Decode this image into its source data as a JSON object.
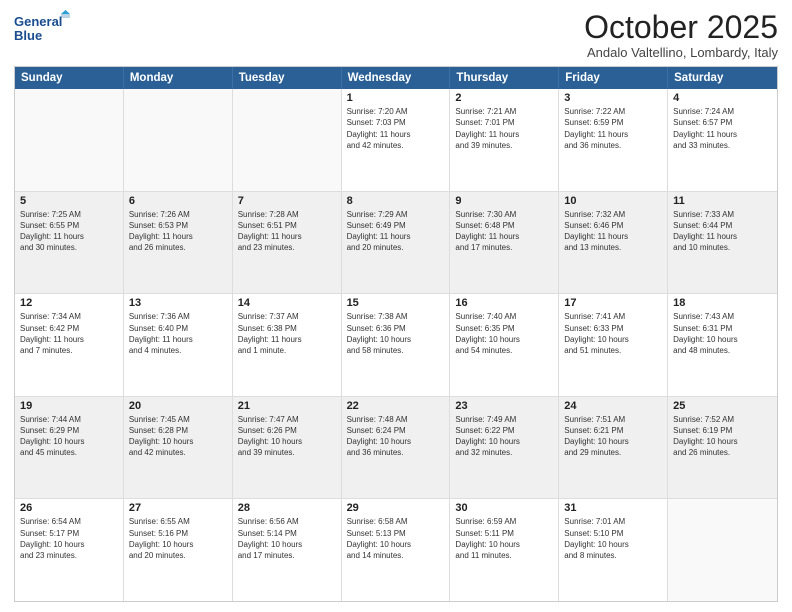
{
  "header": {
    "logo_line1": "General",
    "logo_line2": "Blue",
    "month_title": "October 2025",
    "location": "Andalo Valtellino, Lombardy, Italy"
  },
  "weekdays": [
    "Sunday",
    "Monday",
    "Tuesday",
    "Wednesday",
    "Thursday",
    "Friday",
    "Saturday"
  ],
  "rows": [
    [
      {
        "day": "",
        "info": ""
      },
      {
        "day": "",
        "info": ""
      },
      {
        "day": "",
        "info": ""
      },
      {
        "day": "1",
        "info": "Sunrise: 7:20 AM\nSunset: 7:03 PM\nDaylight: 11 hours\nand 42 minutes."
      },
      {
        "day": "2",
        "info": "Sunrise: 7:21 AM\nSunset: 7:01 PM\nDaylight: 11 hours\nand 39 minutes."
      },
      {
        "day": "3",
        "info": "Sunrise: 7:22 AM\nSunset: 6:59 PM\nDaylight: 11 hours\nand 36 minutes."
      },
      {
        "day": "4",
        "info": "Sunrise: 7:24 AM\nSunset: 6:57 PM\nDaylight: 11 hours\nand 33 minutes."
      }
    ],
    [
      {
        "day": "5",
        "info": "Sunrise: 7:25 AM\nSunset: 6:55 PM\nDaylight: 11 hours\nand 30 minutes."
      },
      {
        "day": "6",
        "info": "Sunrise: 7:26 AM\nSunset: 6:53 PM\nDaylight: 11 hours\nand 26 minutes."
      },
      {
        "day": "7",
        "info": "Sunrise: 7:28 AM\nSunset: 6:51 PM\nDaylight: 11 hours\nand 23 minutes."
      },
      {
        "day": "8",
        "info": "Sunrise: 7:29 AM\nSunset: 6:49 PM\nDaylight: 11 hours\nand 20 minutes."
      },
      {
        "day": "9",
        "info": "Sunrise: 7:30 AM\nSunset: 6:48 PM\nDaylight: 11 hours\nand 17 minutes."
      },
      {
        "day": "10",
        "info": "Sunrise: 7:32 AM\nSunset: 6:46 PM\nDaylight: 11 hours\nand 13 minutes."
      },
      {
        "day": "11",
        "info": "Sunrise: 7:33 AM\nSunset: 6:44 PM\nDaylight: 11 hours\nand 10 minutes."
      }
    ],
    [
      {
        "day": "12",
        "info": "Sunrise: 7:34 AM\nSunset: 6:42 PM\nDaylight: 11 hours\nand 7 minutes."
      },
      {
        "day": "13",
        "info": "Sunrise: 7:36 AM\nSunset: 6:40 PM\nDaylight: 11 hours\nand 4 minutes."
      },
      {
        "day": "14",
        "info": "Sunrise: 7:37 AM\nSunset: 6:38 PM\nDaylight: 11 hours\nand 1 minute."
      },
      {
        "day": "15",
        "info": "Sunrise: 7:38 AM\nSunset: 6:36 PM\nDaylight: 10 hours\nand 58 minutes."
      },
      {
        "day": "16",
        "info": "Sunrise: 7:40 AM\nSunset: 6:35 PM\nDaylight: 10 hours\nand 54 minutes."
      },
      {
        "day": "17",
        "info": "Sunrise: 7:41 AM\nSunset: 6:33 PM\nDaylight: 10 hours\nand 51 minutes."
      },
      {
        "day": "18",
        "info": "Sunrise: 7:43 AM\nSunset: 6:31 PM\nDaylight: 10 hours\nand 48 minutes."
      }
    ],
    [
      {
        "day": "19",
        "info": "Sunrise: 7:44 AM\nSunset: 6:29 PM\nDaylight: 10 hours\nand 45 minutes."
      },
      {
        "day": "20",
        "info": "Sunrise: 7:45 AM\nSunset: 6:28 PM\nDaylight: 10 hours\nand 42 minutes."
      },
      {
        "day": "21",
        "info": "Sunrise: 7:47 AM\nSunset: 6:26 PM\nDaylight: 10 hours\nand 39 minutes."
      },
      {
        "day": "22",
        "info": "Sunrise: 7:48 AM\nSunset: 6:24 PM\nDaylight: 10 hours\nand 36 minutes."
      },
      {
        "day": "23",
        "info": "Sunrise: 7:49 AM\nSunset: 6:22 PM\nDaylight: 10 hours\nand 32 minutes."
      },
      {
        "day": "24",
        "info": "Sunrise: 7:51 AM\nSunset: 6:21 PM\nDaylight: 10 hours\nand 29 minutes."
      },
      {
        "day": "25",
        "info": "Sunrise: 7:52 AM\nSunset: 6:19 PM\nDaylight: 10 hours\nand 26 minutes."
      }
    ],
    [
      {
        "day": "26",
        "info": "Sunrise: 6:54 AM\nSunset: 5:17 PM\nDaylight: 10 hours\nand 23 minutes."
      },
      {
        "day": "27",
        "info": "Sunrise: 6:55 AM\nSunset: 5:16 PM\nDaylight: 10 hours\nand 20 minutes."
      },
      {
        "day": "28",
        "info": "Sunrise: 6:56 AM\nSunset: 5:14 PM\nDaylight: 10 hours\nand 17 minutes."
      },
      {
        "day": "29",
        "info": "Sunrise: 6:58 AM\nSunset: 5:13 PM\nDaylight: 10 hours\nand 14 minutes."
      },
      {
        "day": "30",
        "info": "Sunrise: 6:59 AM\nSunset: 5:11 PM\nDaylight: 10 hours\nand 11 minutes."
      },
      {
        "day": "31",
        "info": "Sunrise: 7:01 AM\nSunset: 5:10 PM\nDaylight: 10 hours\nand 8 minutes."
      },
      {
        "day": "",
        "info": ""
      }
    ]
  ]
}
